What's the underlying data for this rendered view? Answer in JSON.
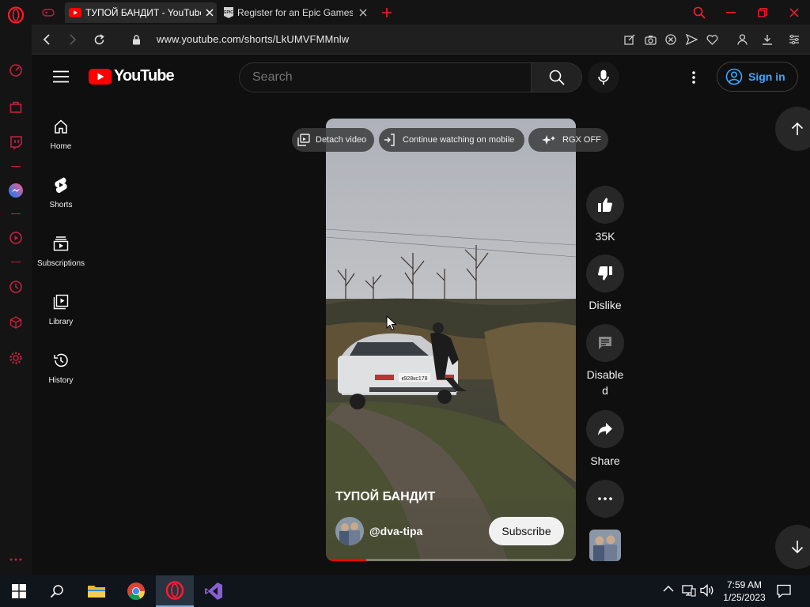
{
  "browser": {
    "tabs": [
      {
        "title": "ТУПОЙ БАНДИТ - YouTube",
        "active": true,
        "favicon": "youtube-icon"
      },
      {
        "title": "Register for an Epic Games",
        "active": false,
        "favicon": "epic-games-icon"
      }
    ],
    "url": "www.youtube.com/shorts/LkUMVFMMnlw"
  },
  "youtube": {
    "logo_text": "YouTube",
    "search_placeholder": "Search",
    "sign_in_label": "Sign in",
    "guide": [
      {
        "label": "Home",
        "icon": "home-icon"
      },
      {
        "label": "Shorts",
        "icon": "shorts-icon"
      },
      {
        "label": "Subscriptions",
        "icon": "subscriptions-icon"
      },
      {
        "label": "Library",
        "icon": "library-icon"
      },
      {
        "label": "History",
        "icon": "history-icon"
      }
    ],
    "overlay": {
      "detach_label": "Detach video",
      "continue_label": "Continue watching on mobile",
      "rgx_label": "RGX OFF"
    },
    "short": {
      "title": "ТУПОЙ БАНДИТ",
      "channel": "@dva-tipa",
      "subscribe_label": "Subscribe",
      "progress": 0.16
    },
    "actions": {
      "like": "35K",
      "dislike": "Dislike",
      "comments": "Disabled",
      "share": "Share"
    }
  },
  "taskbar": {
    "time": "7:59 AM",
    "date": "1/25/2023"
  },
  "colors": {
    "opera_red": "#ff1b2d",
    "youtube_red": "#ff0000",
    "link_blue": "#3ea6ff"
  }
}
